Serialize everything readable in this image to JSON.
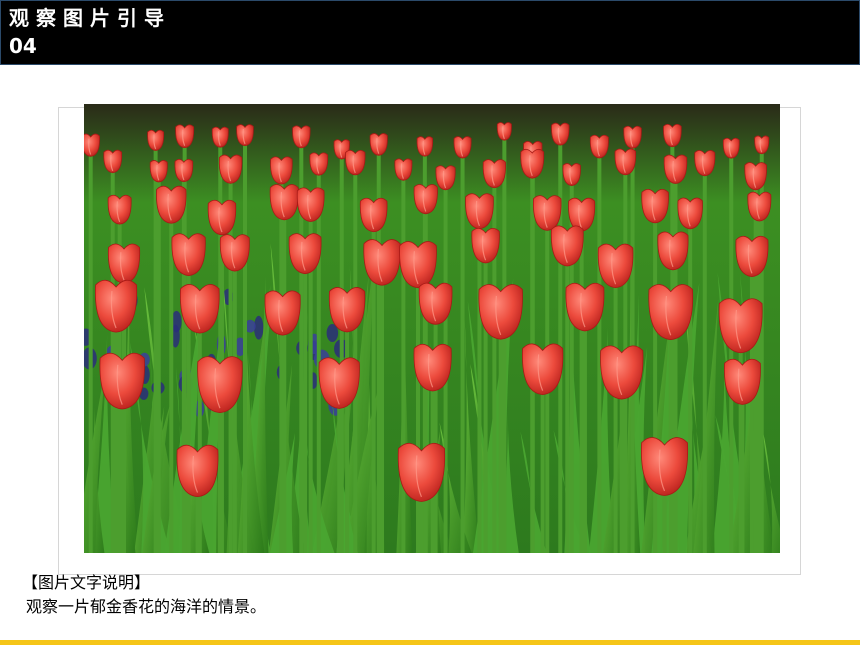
{
  "header": {
    "title": "观察图片引导",
    "number": "04"
  },
  "photo": {
    "subject": "tulip-field-image"
  },
  "caption": {
    "heading": "【图片文字说明】",
    "text": "观察一片郁金香花的海洋的情景。"
  },
  "colors": {
    "header_bg": "#000000",
    "accent_bar": "#f5c518",
    "tulip_red": "#e8403a",
    "leaf_green": "#3f9a2c"
  }
}
